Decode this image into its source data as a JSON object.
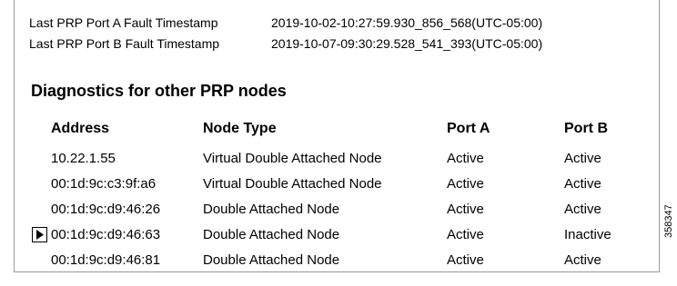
{
  "timestamps": [
    {
      "label": "Last PRP Port A Fault Timestamp",
      "value": "2019-10-02-10:27:59.930_856_568(UTC-05:00)"
    },
    {
      "label": "Last PRP Port B Fault Timestamp",
      "value": "2019-10-07-09:30:29.528_541_393(UTC-05:00)"
    }
  ],
  "diagnostics": {
    "heading": "Diagnostics for other PRP nodes",
    "columns": {
      "address": "Address",
      "node_type": "Node Type",
      "port_a": "Port A",
      "port_b": "Port B"
    },
    "rows": [
      {
        "address": "10.22.1.55",
        "node_type": "Virtual Double Attached Node",
        "port_a": "Active",
        "port_b": "Active"
      },
      {
        "address": "00:1d:9c:c3:9f:a6",
        "node_type": "Virtual Double Attached Node",
        "port_a": "Active",
        "port_b": "Active"
      },
      {
        "address": "00:1d:9c:d9:46:26",
        "node_type": "Double Attached Node",
        "port_a": "Active",
        "port_b": "Active"
      },
      {
        "address": "00:1d:9c:d9:46:63",
        "node_type": "Double Attached Node",
        "port_a": "Active",
        "port_b": "Inactive"
      },
      {
        "address": "00:1d:9c:d9:46:81",
        "node_type": "Double Attached Node",
        "port_a": "Active",
        "port_b": "Active"
      }
    ]
  },
  "current_row_icon": "row-selector-arrow-icon",
  "figure_id": "358347"
}
